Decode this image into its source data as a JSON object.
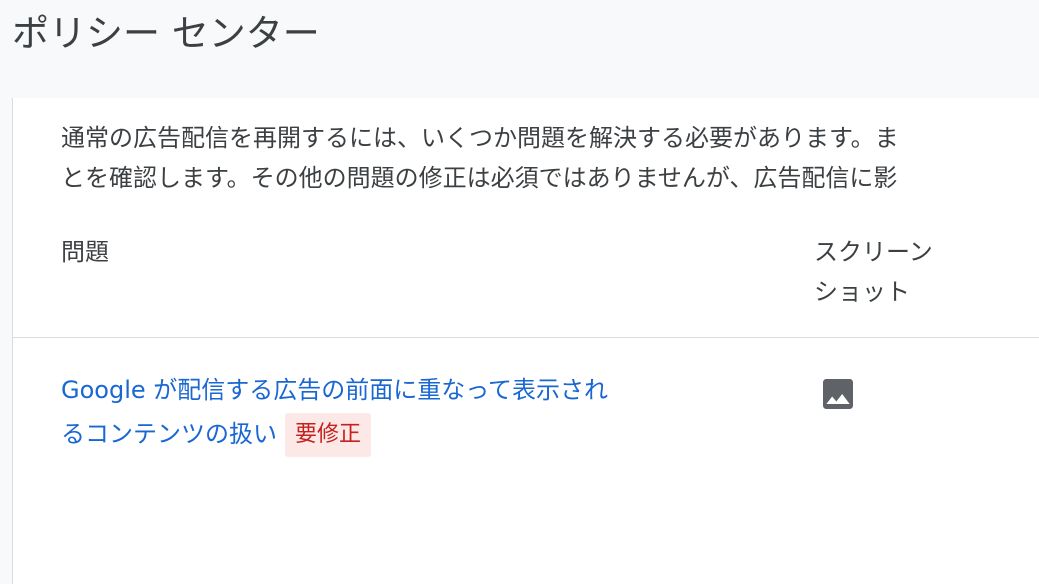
{
  "header": {
    "title": "ポリシー センター"
  },
  "description": {
    "line1": "通常の広告配信を再開するには、いくつか問題を解決する必要があります。ま",
    "line2": "とを確認します。その他の問題の修正は必須ではありませんが、広告配信に影"
  },
  "table": {
    "columns": {
      "issue": "問題",
      "screenshot_line1": "スクリーン",
      "screenshot_line2": "ショット"
    },
    "rows": [
      {
        "issue_line1": "Google が配信する広告の前面に重なって表示され",
        "issue_line2": "るコンテンツの扱い",
        "badge": "要修正",
        "screenshot_icon": "image-icon"
      }
    ]
  },
  "colors": {
    "link": "#1967d2",
    "badge_background": "#fce8e6",
    "badge_text": "#c5221f"
  }
}
